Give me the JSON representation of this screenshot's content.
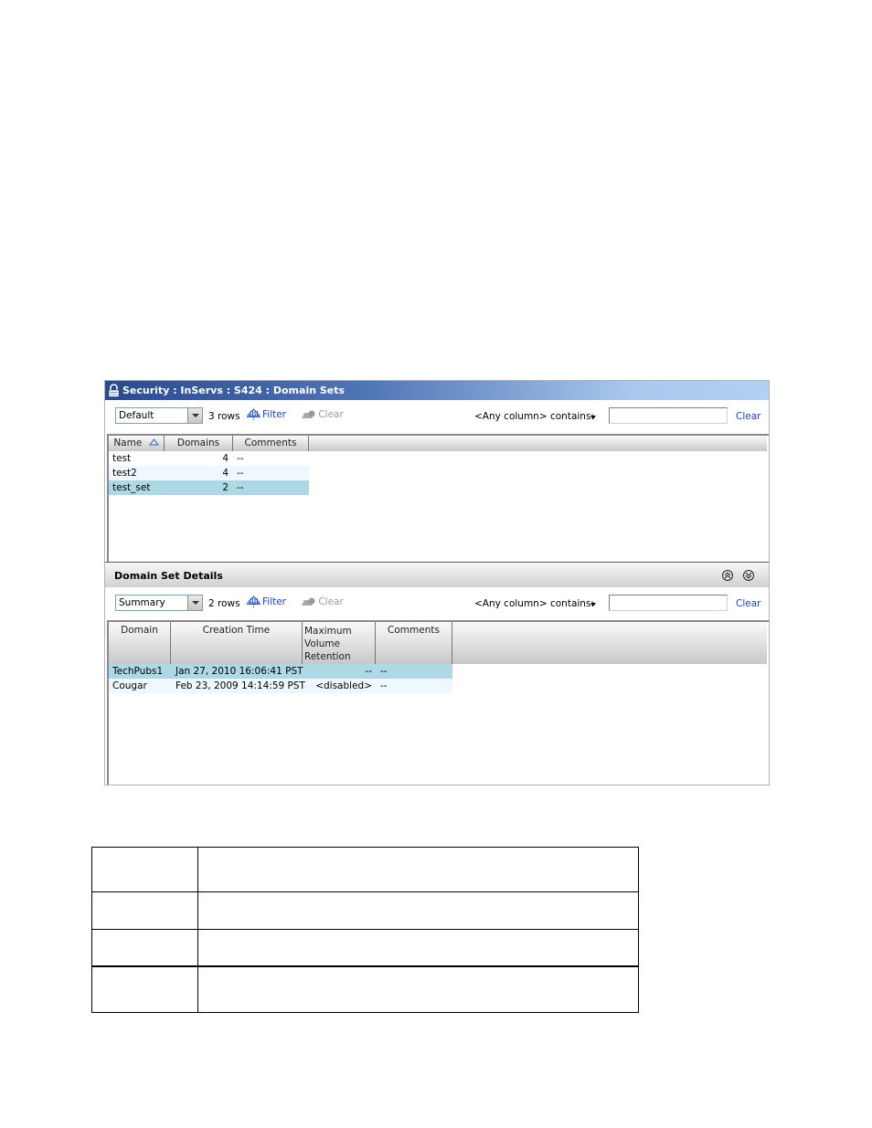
{
  "window": {
    "title": "Security : InServs : S424 : Domain Sets",
    "title_icon": "lock-icon"
  },
  "top_panel": {
    "view_select": "Default",
    "row_count": "3 rows",
    "filter_label": "Filter",
    "clear_label": "Clear",
    "search_scope": "<Any column> contains:",
    "search_value": "",
    "search_clear_label": "Clear",
    "columns": [
      "Name",
      "Domains",
      "Comments"
    ],
    "sort_column": "Name",
    "sort_direction": "ascending",
    "rows": [
      {
        "name": "test",
        "domains": "4",
        "comments": "--",
        "selected": false
      },
      {
        "name": "test2",
        "domains": "4",
        "comments": "--",
        "selected": false
      },
      {
        "name": "test_set",
        "domains": "2",
        "comments": "--",
        "selected": true
      }
    ]
  },
  "details_panel": {
    "title": "Domain Set Details",
    "collapse_icon": "double-chevron-up-icon",
    "expand_icon": "double-chevron-down-icon",
    "view_select": "Summary",
    "row_count": "2 rows",
    "filter_label": "Filter",
    "clear_label": "Clear",
    "search_scope": "<Any column> contains:",
    "search_value": "",
    "search_clear_label": "Clear",
    "columns": [
      "Domain",
      "Creation Time",
      "Maximum Volume Retention Time",
      "Comments"
    ],
    "column_header_lines": {
      "retention": [
        "Maximum",
        "Volume",
        "Retention Time"
      ]
    },
    "rows": [
      {
        "domain": "TechPubs1",
        "creation_time": "Jan 27, 2010 16:06:41 PST",
        "max_retention": "--",
        "comments": "--",
        "selected": true
      },
      {
        "domain": "Cougar",
        "creation_time": "Feb 23, 2009 14:14:59 PST",
        "max_retention": "<disabled>",
        "comments": "--",
        "selected": false
      }
    ]
  },
  "document_table": {
    "rows": [
      [
        "",
        ""
      ],
      [
        "",
        ""
      ],
      [
        "",
        ""
      ],
      [
        "",
        ""
      ]
    ]
  }
}
